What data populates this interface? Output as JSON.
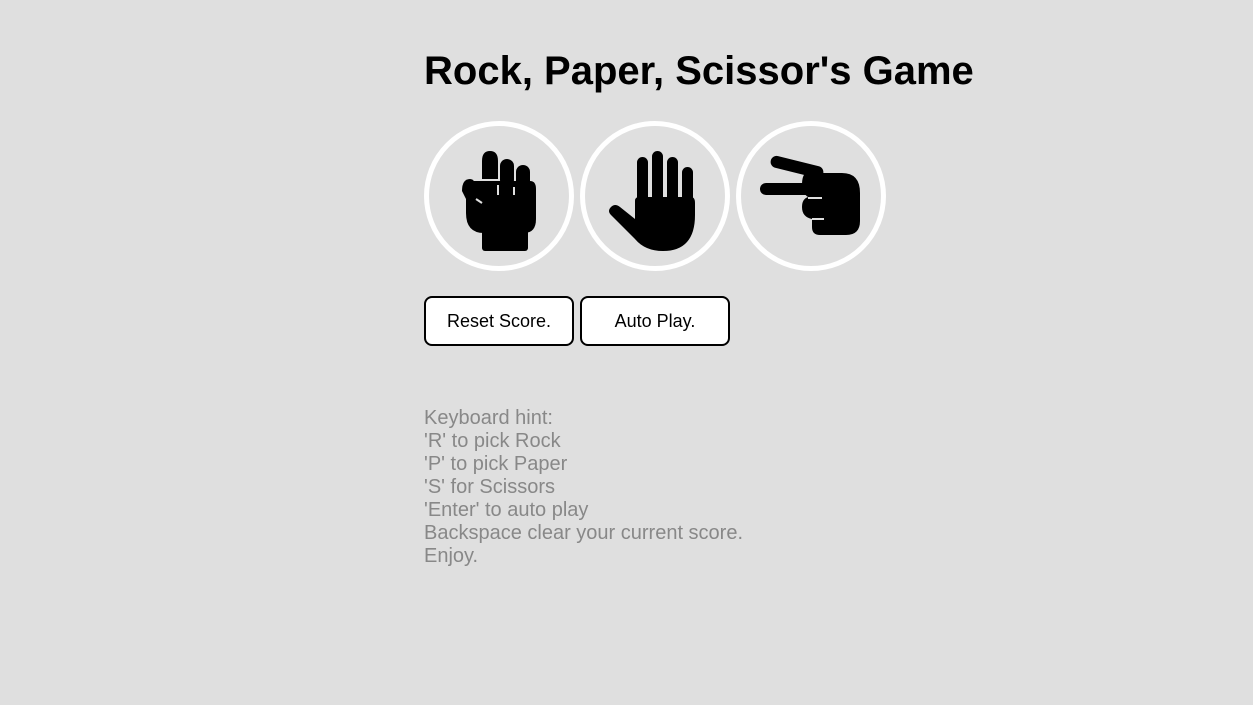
{
  "page": {
    "title": "Rock, Paper, Scissor's Game",
    "background_color": "#dfdfdf"
  },
  "moves": [
    {
      "name": "rock",
      "icon": "rock-fist-icon"
    },
    {
      "name": "paper",
      "icon": "paper-hand-icon"
    },
    {
      "name": "scissors",
      "icon": "scissors-hand-icon"
    }
  ],
  "controls": {
    "reset_label": "Reset Score.",
    "auto_play_label": "Auto Play."
  },
  "hints": {
    "heading": "Keyboard hint:",
    "lines": [
      "'R' to pick Rock",
      "'P' to pick Paper",
      "'S' for Scissors",
      "'Enter' to auto play",
      "Backspace clear your current score.",
      "Enjoy."
    ]
  }
}
